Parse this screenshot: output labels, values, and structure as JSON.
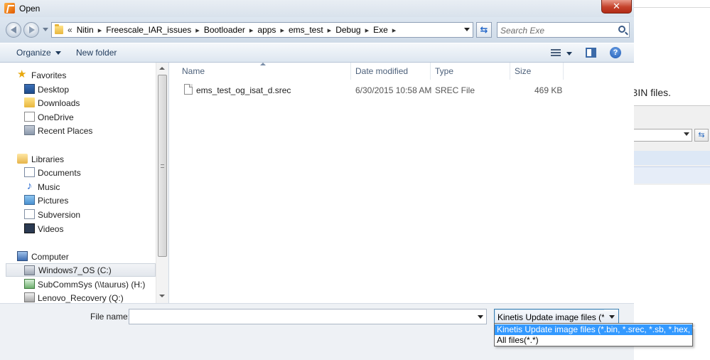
{
  "window": {
    "title": "Open",
    "close_label": "✕"
  },
  "address": {
    "lead": "«",
    "crumbs": [
      "Nitin",
      "Freescale_IAR_issues",
      "Bootloader",
      "apps",
      "ems_test",
      "Debug",
      "Exe"
    ],
    "separator": "▸",
    "search_placeholder": "Search Exe"
  },
  "toolbar": {
    "organize": "Organize",
    "new_folder": "New folder",
    "help": "?"
  },
  "nav": {
    "favorites": {
      "label": "Favorites",
      "items": [
        "Desktop",
        "Downloads",
        "OneDrive",
        "Recent Places"
      ]
    },
    "libraries": {
      "label": "Libraries",
      "items": [
        "Documents",
        "Music",
        "Pictures",
        "Subversion",
        "Videos"
      ]
    },
    "computer": {
      "label": "Computer",
      "items": [
        "Windows7_OS (C:)",
        "SubCommSys (\\\\taurus) (H:)",
        "Lenovo_Recovery (Q:)"
      ]
    }
  },
  "columns": {
    "name": "Name",
    "date": "Date modified",
    "type": "Type",
    "size": "Size"
  },
  "files": [
    {
      "name": "ems_test_og_isat_d.srec",
      "date": "6/30/2015 10:58 AM",
      "type": "SREC File",
      "size": "469 KB"
    }
  ],
  "footer": {
    "file_name_label": "File name:",
    "file_name_value": "",
    "filter_selected": "Kinetis Update image files (*.bin, *.srec, *.sb, *.hex, *.elf)",
    "filter_options": [
      "Kinetis Update image files (*.bin, *.srec, *.sb, *.hex, *.elf)",
      "All files(*.*)"
    ]
  },
  "background": {
    "snippet": "BIN files."
  }
}
